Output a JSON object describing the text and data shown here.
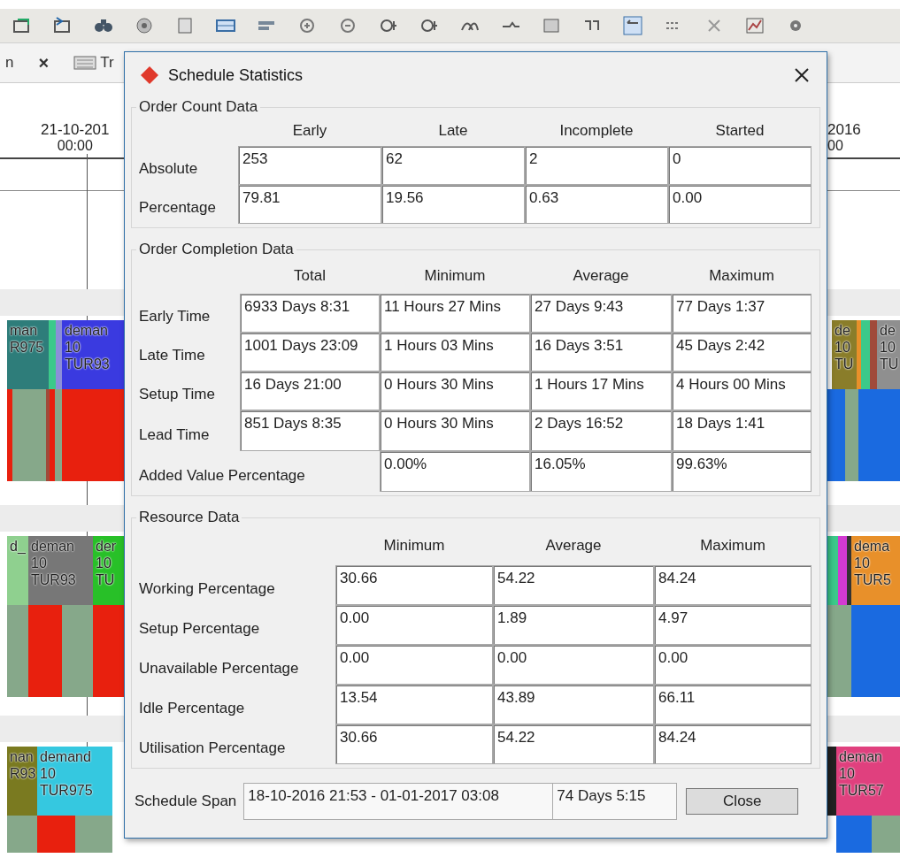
{
  "tab_strip": {
    "items": [
      {
        "kind": "text",
        "label": "n"
      },
      {
        "kind": "close",
        "label": "×"
      },
      {
        "kind": "icon-tab",
        "label": "Tr"
      }
    ]
  },
  "timeline": {
    "labels": [
      {
        "date": "21-10-201",
        "time": "00:00"
      },
      {
        "date": "2016",
        "time": "00"
      }
    ]
  },
  "gantt": {
    "rows": [
      {
        "blocks": [
          {
            "lines": [
              "man",
              "R975"
            ],
            "color": "#2e7d7a"
          },
          {
            "lines": [
              "deman",
              "10",
              "TUR93"
            ],
            "color": "#3a3ae0"
          },
          {
            "lines": [
              "de",
              "10",
              "TU"
            ],
            "color": "#8a7d2a"
          },
          {
            "lines": [
              "de",
              "10",
              "TU"
            ],
            "color": "#8f8f8f"
          }
        ]
      },
      {
        "blocks": [
          {
            "lines": [
              "d_"
            ],
            "color": "#8fd08f"
          },
          {
            "lines": [
              "deman",
              "10",
              "TUR93"
            ],
            "color": "#777777"
          },
          {
            "lines": [
              "der",
              "10",
              "TU"
            ],
            "color": "#28c028"
          },
          {
            "lines": [
              "dema",
              "10",
              "TUR5"
            ],
            "color": "#e8902a"
          }
        ]
      },
      {
        "blocks": [
          {
            "lines": [
              "nan",
              "R93"
            ],
            "color": "#7a7a20"
          },
          {
            "lines": [
              "demand",
              "10",
              "TUR975"
            ],
            "color": "#35c8e0"
          },
          {
            "lines": [
              "deman",
              "10",
              "TUR57"
            ],
            "color": "#e0407e"
          }
        ]
      }
    ]
  },
  "dialog": {
    "title": "Schedule Statistics",
    "sections": [
      {
        "title": "Order Count Data",
        "kind": "count",
        "columns": [
          "Early",
          "Late",
          "Incomplete",
          "Started"
        ],
        "rows": [
          {
            "label": "Absolute",
            "values": [
              "253",
              "62",
              "2",
              "0"
            ]
          },
          {
            "label": "Percentage",
            "values": [
              "79.81",
              "19.56",
              "0.63",
              "0.00"
            ]
          }
        ]
      },
      {
        "title": "Order Completion Data",
        "kind": "completion",
        "columns": [
          "Total",
          "Minimum",
          "Average",
          "Maximum"
        ],
        "rows": [
          {
            "label": "Early Time",
            "values": [
              "6933 Days 8:31",
              "11 Hours 27 Mins",
              "27 Days 9:43",
              "77 Days 1:37"
            ]
          },
          {
            "label": "Late Time",
            "values": [
              "1001 Days 23:09",
              "1 Hours 03 Mins",
              "16 Days 3:51",
              "45 Days 2:42"
            ]
          },
          {
            "label": "Setup Time",
            "values": [
              "16 Days 21:00",
              "0 Hours 30 Mins",
              "1 Hours 17 Mins",
              "4 Hours 00 Mins"
            ]
          },
          {
            "label": "Lead Time",
            "values": [
              "851 Days 8:35",
              "0 Hours 30 Mins",
              "2 Days 16:52",
              "18 Days 1:41"
            ]
          },
          {
            "label": "Added Value Percentage",
            "values": [
              "0.00%",
              "16.05%",
              "99.63%"
            ]
          }
        ]
      },
      {
        "title": "Resource Data",
        "kind": "resource",
        "columns": [
          "Minimum",
          "Average",
          "Maximum"
        ],
        "rows": [
          {
            "label": "Working Percentage",
            "values": [
              "30.66",
              "54.22",
              "84.24"
            ]
          },
          {
            "label": "Setup Percentage",
            "values": [
              "0.00",
              "1.89",
              "4.97"
            ]
          },
          {
            "label": "Unavailable Percentage",
            "values": [
              "0.00",
              "0.00",
              "0.00"
            ]
          },
          {
            "label": "Idle Percentage",
            "values": [
              "13.54",
              "43.89",
              "66.11"
            ]
          },
          {
            "label": "Utilisation Percentage",
            "values": [
              "30.66",
              "54.22",
              "84.24"
            ]
          }
        ]
      }
    ],
    "footer": {
      "label": "Schedule Span",
      "span": "18-10-2016 21:53 - 01-01-2017 03:08",
      "duration": "74 Days 5:15",
      "button": "Close"
    }
  }
}
